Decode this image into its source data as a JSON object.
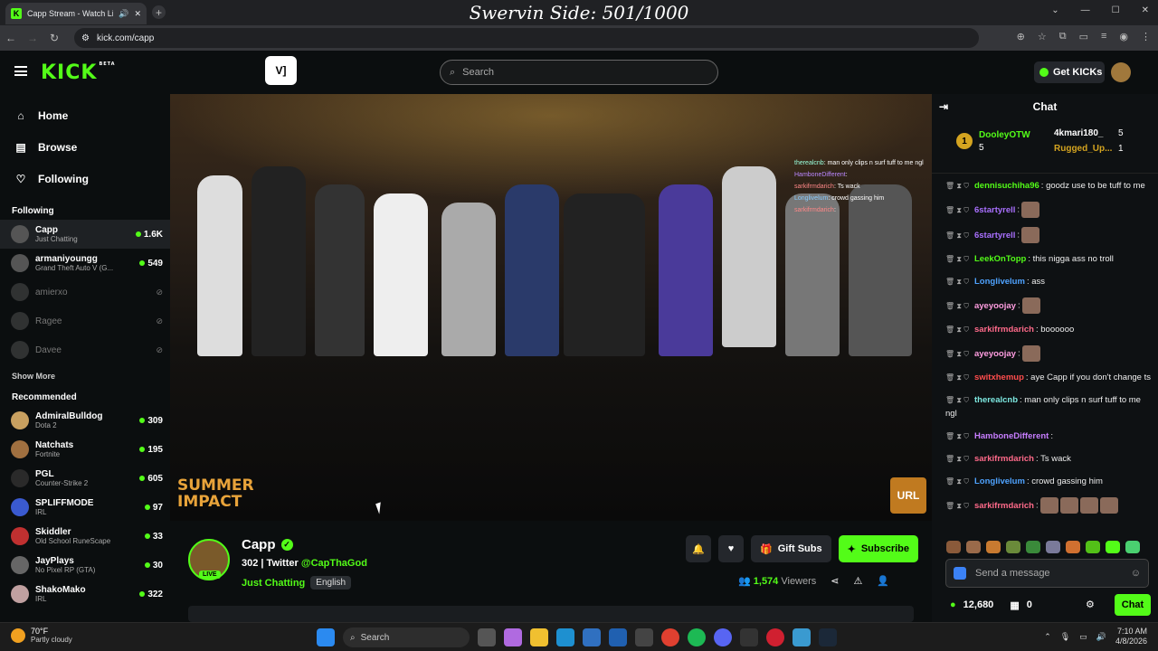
{
  "browser": {
    "tab_title": "Capp Stream - Watch Live o",
    "url": "kick.com/capp",
    "overlay_title": "Swervin Side: 501/1000"
  },
  "header": {
    "logo": "KICK",
    "logo_badge": "BETA",
    "search_placeholder": "Search",
    "get_kicks_label": "Get KICKs"
  },
  "sidebar": {
    "nav": [
      {
        "label": "Home",
        "icon": "home-icon"
      },
      {
        "label": "Browse",
        "icon": "browse-icon"
      },
      {
        "label": "Following",
        "icon": "heart-icon"
      }
    ],
    "following_header": "Following",
    "following": [
      {
        "name": "Capp",
        "game": "Just Chatting",
        "viewers": "1.6K",
        "online": true
      },
      {
        "name": "armaniyoungg",
        "game": "Grand Theft Auto V (G...",
        "viewers": "549",
        "online": true
      },
      {
        "name": "amierxo",
        "game": "",
        "viewers": "",
        "online": false
      },
      {
        "name": "Ragee",
        "game": "",
        "viewers": "",
        "online": false
      },
      {
        "name": "Davee",
        "game": "",
        "viewers": "",
        "online": false
      }
    ],
    "show_more": "Show More",
    "recommended_header": "Recommended",
    "recommended": [
      {
        "name": "AdmiralBulldog",
        "game": "Dota 2",
        "viewers": "309"
      },
      {
        "name": "Natchats",
        "game": "Fortnite",
        "viewers": "195"
      },
      {
        "name": "PGL",
        "game": "Counter-Strike 2",
        "viewers": "605"
      },
      {
        "name": "SPLIFFMODE",
        "game": "IRL",
        "viewers": "97"
      },
      {
        "name": "Skiddler",
        "game": "Old School RuneScape",
        "viewers": "33"
      },
      {
        "name": "JayPlays",
        "game": "No Pixel RP (GTA)",
        "viewers": "30"
      },
      {
        "name": "ShakoMako",
        "game": "IRL",
        "viewers": "322"
      }
    ]
  },
  "video": {
    "overlay_chat": [
      {
        "user": "therealcnb",
        "text": ": man only clips n surf tuff to me ngl"
      },
      {
        "user": "HamboneDifferent",
        "text": ":"
      },
      {
        "user": "sarkifrmdarich",
        "text": ": Ts wack"
      },
      {
        "user": "Longlivelum",
        "text": ": crowd gassing him"
      },
      {
        "user": "sarkifrmdarich",
        "text": ":"
      }
    ],
    "left_logo": "SUMMER IMPACT",
    "right_logo": "URL"
  },
  "channel": {
    "name": "Capp",
    "live_badge": "LIVE",
    "title_prefix": "302 | Twitter",
    "twitter": "@CapThaGod",
    "category": "Just Chatting",
    "language": "English",
    "gift_label": "Gift Subs",
    "subscribe_label": "Subscribe",
    "viewers": "1,574",
    "viewers_label": "Viewers"
  },
  "chat": {
    "title": "Chat",
    "leaderboard": [
      {
        "rank": "1",
        "name": "DooleyOTW",
        "count": "5"
      },
      {
        "name": "4kmari180_",
        "count": "5"
      },
      {
        "name": "Rugged_Up...",
        "count": "1"
      }
    ],
    "messages": [
      {
        "user": "dennisuchiha96",
        "color": "#53fc18",
        "text": ": goodz use to be tuff to me",
        "emotes": 0
      },
      {
        "user": "6startyrell",
        "color": "#a970ff",
        "text": ":",
        "emotes": 1
      },
      {
        "user": "6startyrell",
        "color": "#a970ff",
        "text": ":",
        "emotes": 1
      },
      {
        "user": "LeekOnTopp",
        "color": "#53fc18",
        "text": ": this nigga ass no troll",
        "emotes": 0
      },
      {
        "user": "Longlivelum",
        "color": "#4fa3ff",
        "text": ": ass",
        "emotes": 0
      },
      {
        "user": "ayeyoojay",
        "color": "#ff9de0",
        "text": ":",
        "emotes": 1
      },
      {
        "user": "sarkifrmdarich",
        "color": "#ff6a8a",
        "text": ": boooooo",
        "emotes": 0
      },
      {
        "user": "ayeyoojay",
        "color": "#ff9de0",
        "text": ":",
        "emotes": 1
      },
      {
        "user": "switxhemup",
        "color": "#ff4d4d",
        "text": ": aye Capp if you don't change ts",
        "emotes": 0
      },
      {
        "user": "therealcnb",
        "color": "#7de8e0",
        "text": ": man only clips n surf tuff to me ngl",
        "emotes": 0
      },
      {
        "user": "HamboneDifferent",
        "color": "#c77dff",
        "text": ":",
        "emotes": 0
      },
      {
        "user": "sarkifrmdarich",
        "color": "#ff6a8a",
        "text": ": Ts wack",
        "emotes": 0
      },
      {
        "user": "Longlivelum",
        "color": "#4fa3ff",
        "text": ": crowd gassing him",
        "emotes": 0
      },
      {
        "user": "sarkifrmdarich",
        "color": "#ff6a8a",
        "text": ":",
        "emotes": 4
      }
    ],
    "send_placeholder": "Send a message",
    "kicks_balance": "12,680",
    "other_count": "0",
    "chat_button": "Chat"
  },
  "taskbar": {
    "temp": "70°F",
    "weather": "Partly cloudy",
    "search_label": "Search",
    "time": "7:10 AM",
    "date": "4/8/2026"
  }
}
